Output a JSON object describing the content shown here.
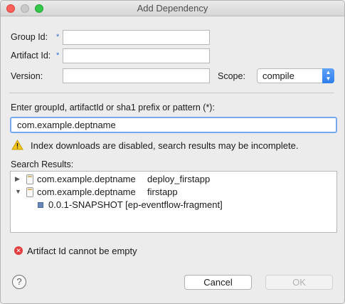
{
  "window": {
    "title": "Add Dependency"
  },
  "form": {
    "group_id_label": "Group Id:",
    "artifact_id_label": "Artifact Id:",
    "version_label": "Version:",
    "required_marker": "*",
    "group_id_value": "",
    "artifact_id_value": "",
    "version_value": "",
    "scope_label": "Scope:",
    "scope_value": "compile"
  },
  "search": {
    "prompt": "Enter groupId, artifactId or sha1 prefix or pattern (*):",
    "value": "com.example.deptname",
    "warning": "Index downloads are disabled, search results may be incomplete.",
    "results_label": "Search Results:",
    "results": [
      {
        "group": "com.example.deptname",
        "artifact": "deploy_firstapp",
        "expanded": false
      },
      {
        "group": "com.example.deptname",
        "artifact": "firstapp",
        "expanded": true,
        "children": [
          {
            "label": "0.0.1-SNAPSHOT [ep-eventflow-fragment]"
          }
        ]
      }
    ]
  },
  "status": {
    "error": "Artifact Id cannot be empty"
  },
  "buttons": {
    "help": "?",
    "cancel": "Cancel",
    "ok": "OK"
  },
  "colors": {
    "error_red": "#e23c3c",
    "accent_blue": "#2f7ef0",
    "warning_yellow": "#f5c518"
  },
  "icons": {
    "warning": "warning-icon",
    "error": "error-icon",
    "jar": "jar-icon",
    "version": "version-icon",
    "help": "help-icon"
  }
}
